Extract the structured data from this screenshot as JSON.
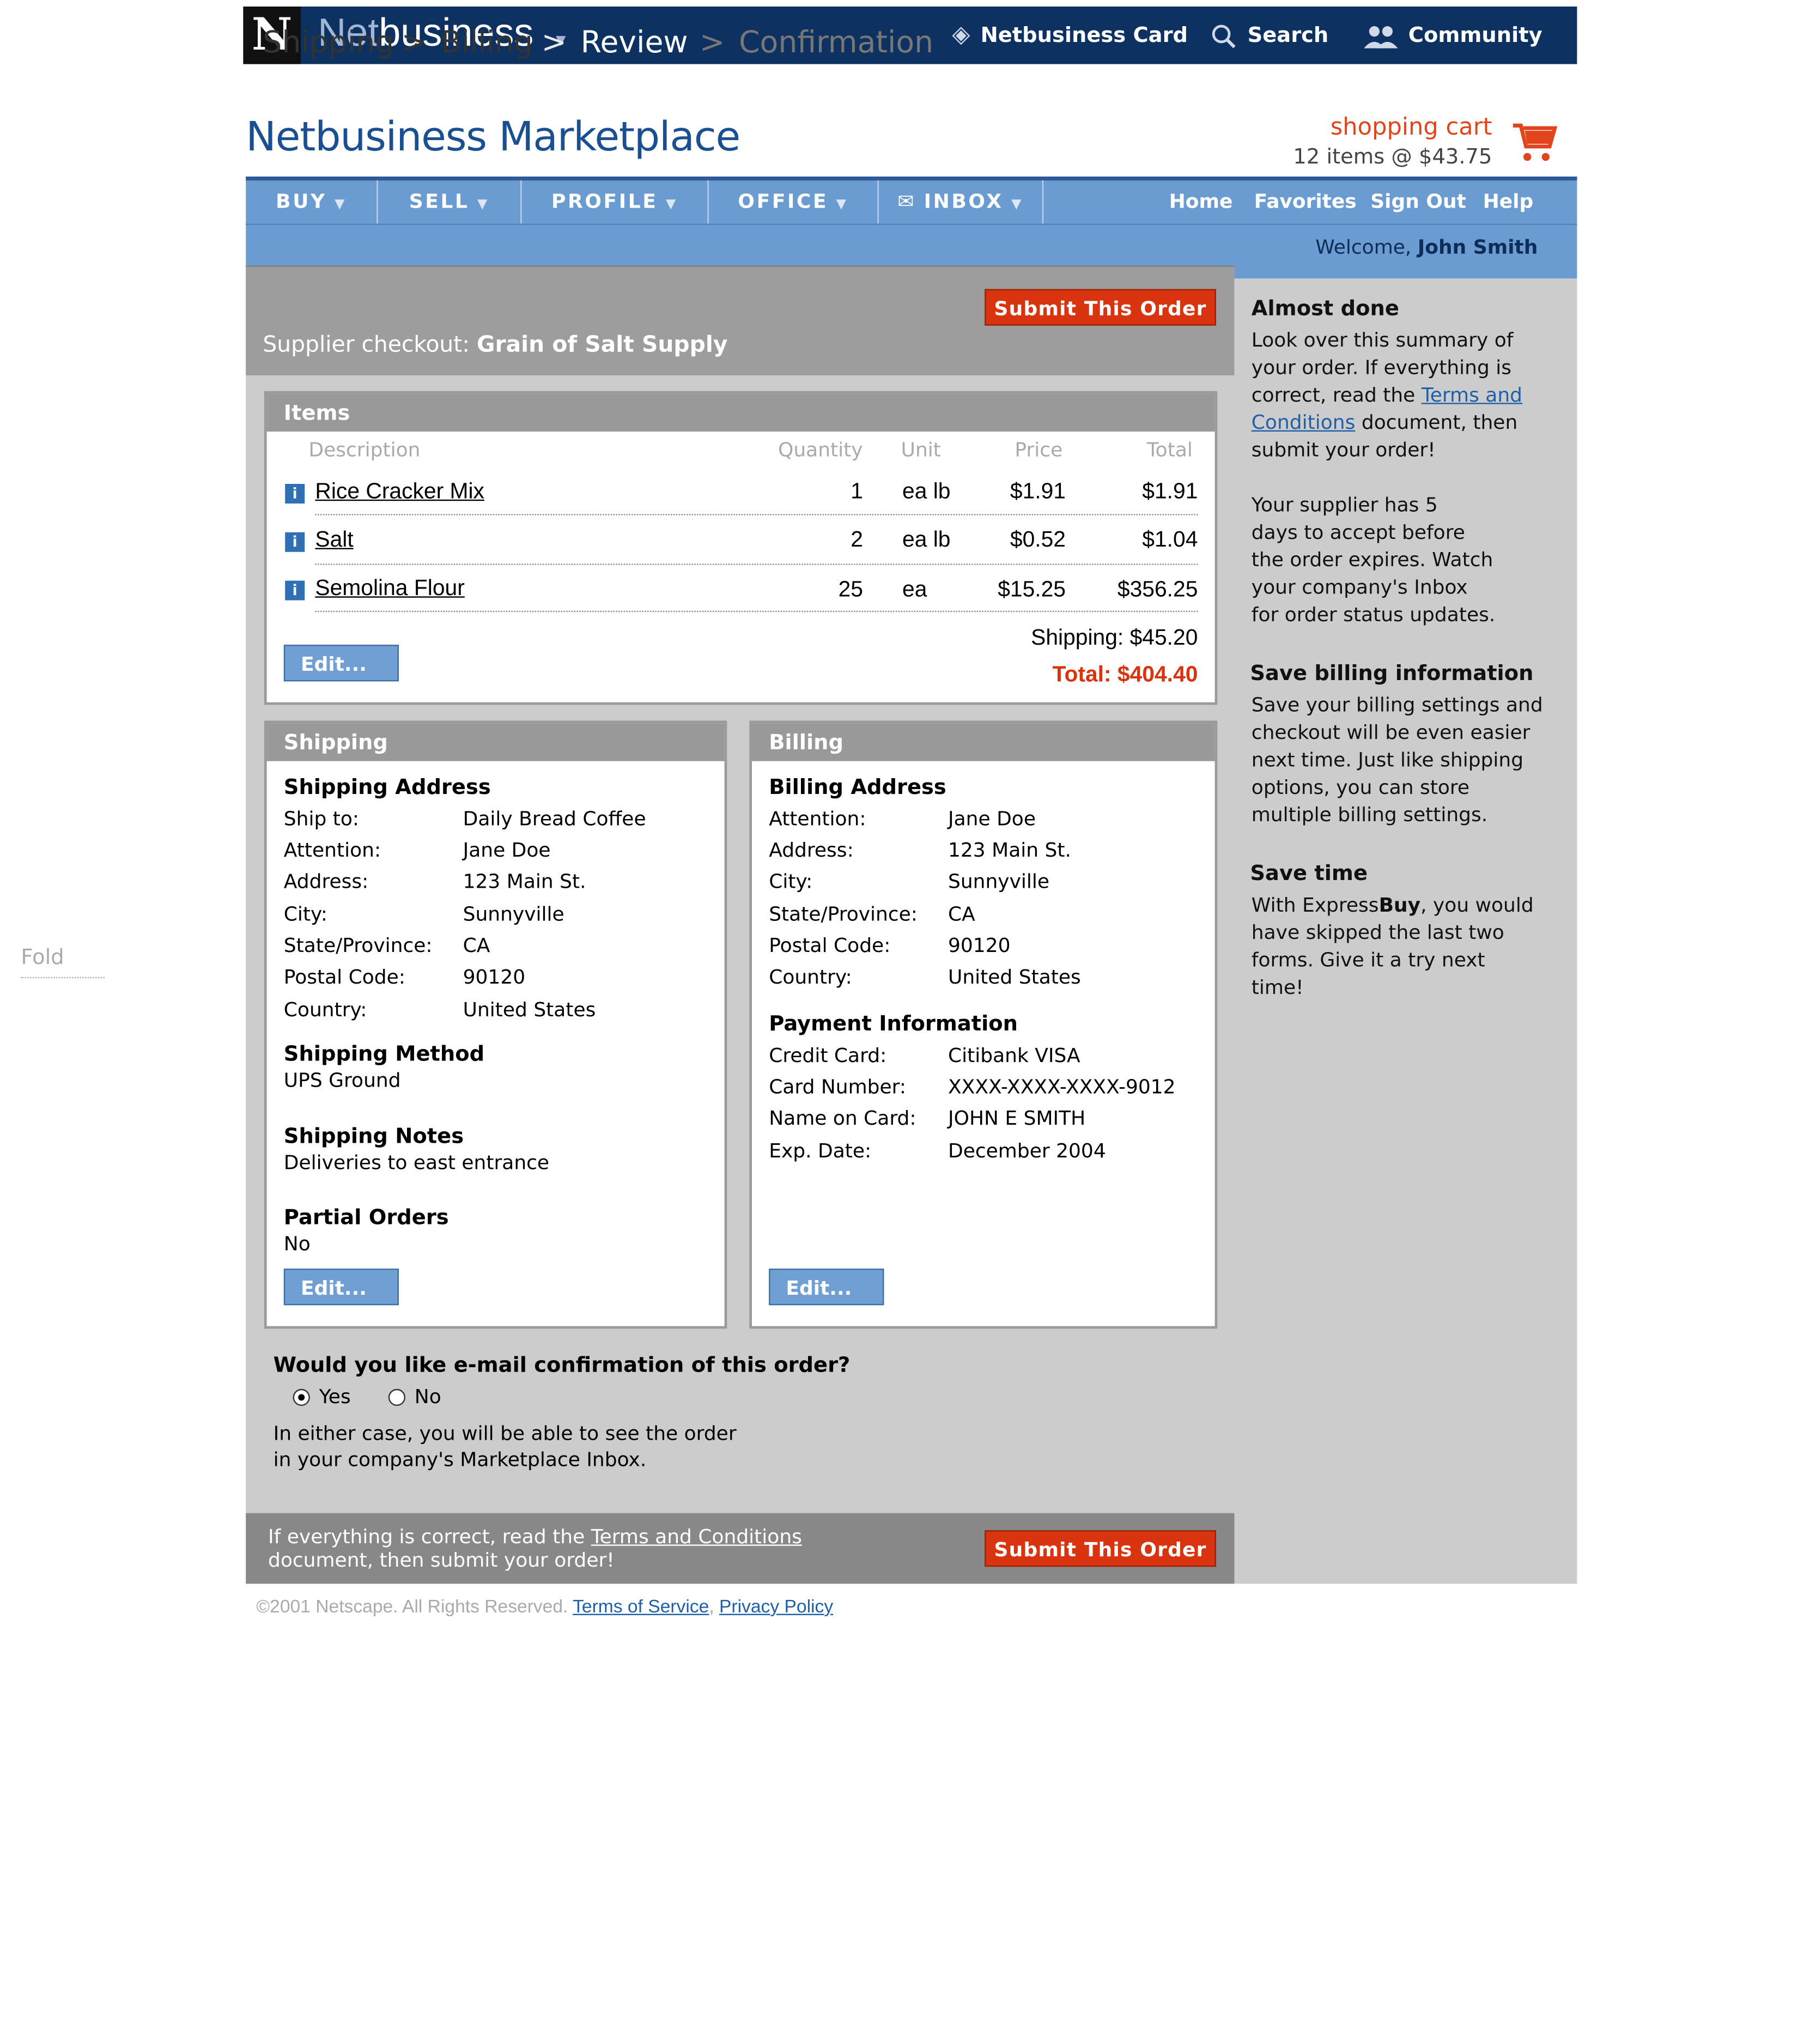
{
  "topbar": {
    "logo_letter": "N",
    "brand_light": "Net",
    "brand_bold": "business",
    "card_link": "Netbusiness Card",
    "search_link": "Search",
    "community_link": "Community"
  },
  "header": {
    "title": "Netbusiness Marketplace",
    "cart_label": "shopping cart",
    "cart_info": "12 items @ $43.75"
  },
  "nav": {
    "items": [
      "BUY",
      "SELL",
      "PROFILE",
      "OFFICE",
      "INBOX"
    ],
    "right": [
      "Home",
      "Favorites",
      "Sign Out",
      "Help"
    ],
    "welcome_prefix": "Welcome,",
    "welcome_name": "John Smith"
  },
  "checkout": {
    "steps": [
      "Shipping",
      "Billing",
      "Review",
      "Confirmation"
    ],
    "separator": ">",
    "supplier_prefix": "Supplier checkout:",
    "supplier_name": "Grain of Salt Supply",
    "submit_label": "Submit This Order"
  },
  "items": {
    "title": "Items",
    "columns": [
      "Description",
      "Quantity",
      "Unit",
      "Price",
      "Total"
    ],
    "rows": [
      {
        "description": "Rice Cracker Mix",
        "quantity": "1",
        "unit": "ea lb",
        "price": "$1.91",
        "total": "$1.91"
      },
      {
        "description": "Salt",
        "quantity": "2",
        "unit": "ea lb",
        "price": "$0.52",
        "total": "$1.04"
      },
      {
        "description": "Semolina Flour",
        "quantity": "25",
        "unit": "ea",
        "price": "$15.25",
        "total": "$356.25"
      }
    ],
    "shipping": "Shipping: $45.20",
    "total": "Total: $404.40",
    "edit_label": "Edit..."
  },
  "shipping": {
    "title": "Shipping",
    "address_heading": "Shipping Address",
    "fields": [
      {
        "label": "Ship to:",
        "value": "Daily Bread Coffee"
      },
      {
        "label": "Attention:",
        "value": "Jane Doe"
      },
      {
        "label": "Address:",
        "value": "123 Main St."
      },
      {
        "label": "City:",
        "value": "Sunnyville"
      },
      {
        "label": "State/Province:",
        "value": "CA"
      },
      {
        "label": "Postal Code:",
        "value": "90120"
      },
      {
        "label": "Country:",
        "value": "United States"
      }
    ],
    "method_heading": "Shipping Method",
    "method_value": "UPS Ground",
    "notes_heading": "Shipping Notes",
    "notes_value": "Deliveries to east entrance",
    "partial_heading": "Partial Orders",
    "partial_value": "No",
    "edit_label": "Edit..."
  },
  "billing": {
    "title": "Billing",
    "address_heading": "Billing Address",
    "fields": [
      {
        "label": "Attention:",
        "value": "Jane Doe"
      },
      {
        "label": "Address:",
        "value": "123 Main St."
      },
      {
        "label": "City:",
        "value": "Sunnyville"
      },
      {
        "label": "State/Province:",
        "value": "CA"
      },
      {
        "label": "Postal Code:",
        "value": "90120"
      },
      {
        "label": "Country:",
        "value": "United States"
      }
    ],
    "payment_heading": "Payment Information",
    "payment_fields": [
      {
        "label": "Credit Card:",
        "value": "Citibank VISA"
      },
      {
        "label": "Card Number:",
        "value": "XXXX-XXXX-XXXX-9012"
      },
      {
        "label": "Name on Card:",
        "value": "JOHN E SMITH"
      },
      {
        "label": "Exp. Date:",
        "value": "December 2004"
      }
    ],
    "edit_label": "Edit..."
  },
  "email_confirm": {
    "question": "Would you like e-mail confirmation of this order?",
    "yes": "Yes",
    "no": "No",
    "selected": "Yes",
    "note_line1": "In either case, you will be able to see the order",
    "note_line2": "in your company's Marketplace Inbox."
  },
  "footer_bar": {
    "text_prefix": "If everything is correct, read the",
    "terms_link": "Terms and Conditions",
    "text_line2": "document, then submit your order!",
    "submit_label": "Submit This Order"
  },
  "sidebar": {
    "h1": "Almost done",
    "p1_line1": "Look over this summary of",
    "p1_line2": "your order. If everything is",
    "p1_line3_prefix": "correct, read the",
    "p1_link_a": "Terms and",
    "p1_link_b": "Conditions",
    "p1_line4_suffix": "document, then",
    "p1_line5": "submit your order!",
    "p2": [
      "Your supplier has 5",
      "days to accept before",
      "the order expires. Watch",
      "your company's Inbox",
      "for order status updates."
    ],
    "h2": "Save billing information",
    "p3": [
      "Save your billing settings and",
      "checkout will be even easier",
      "next time. Just like shipping",
      "options, you can store",
      "multiple billing settings."
    ],
    "h3": "Save time",
    "p4_line1_prefix": "With Express",
    "p4_line1_bold": "Buy",
    "p4_line1_suffix": ", you would",
    "p4_rest": [
      "have skipped the last two",
      "forms. Give it a try next",
      "time!"
    ]
  },
  "copyright": {
    "text": "©2001 Netscape. All Rights Reserved.",
    "tos": "Terms of Service",
    "sep": ",",
    "privacy": "Privacy Policy"
  },
  "fold_label": "Fold",
  "colors": {
    "topbar": "#0d3262",
    "nav": "#6a9bd1",
    "accent": "#d8340f",
    "link": "#1f5fa8"
  }
}
